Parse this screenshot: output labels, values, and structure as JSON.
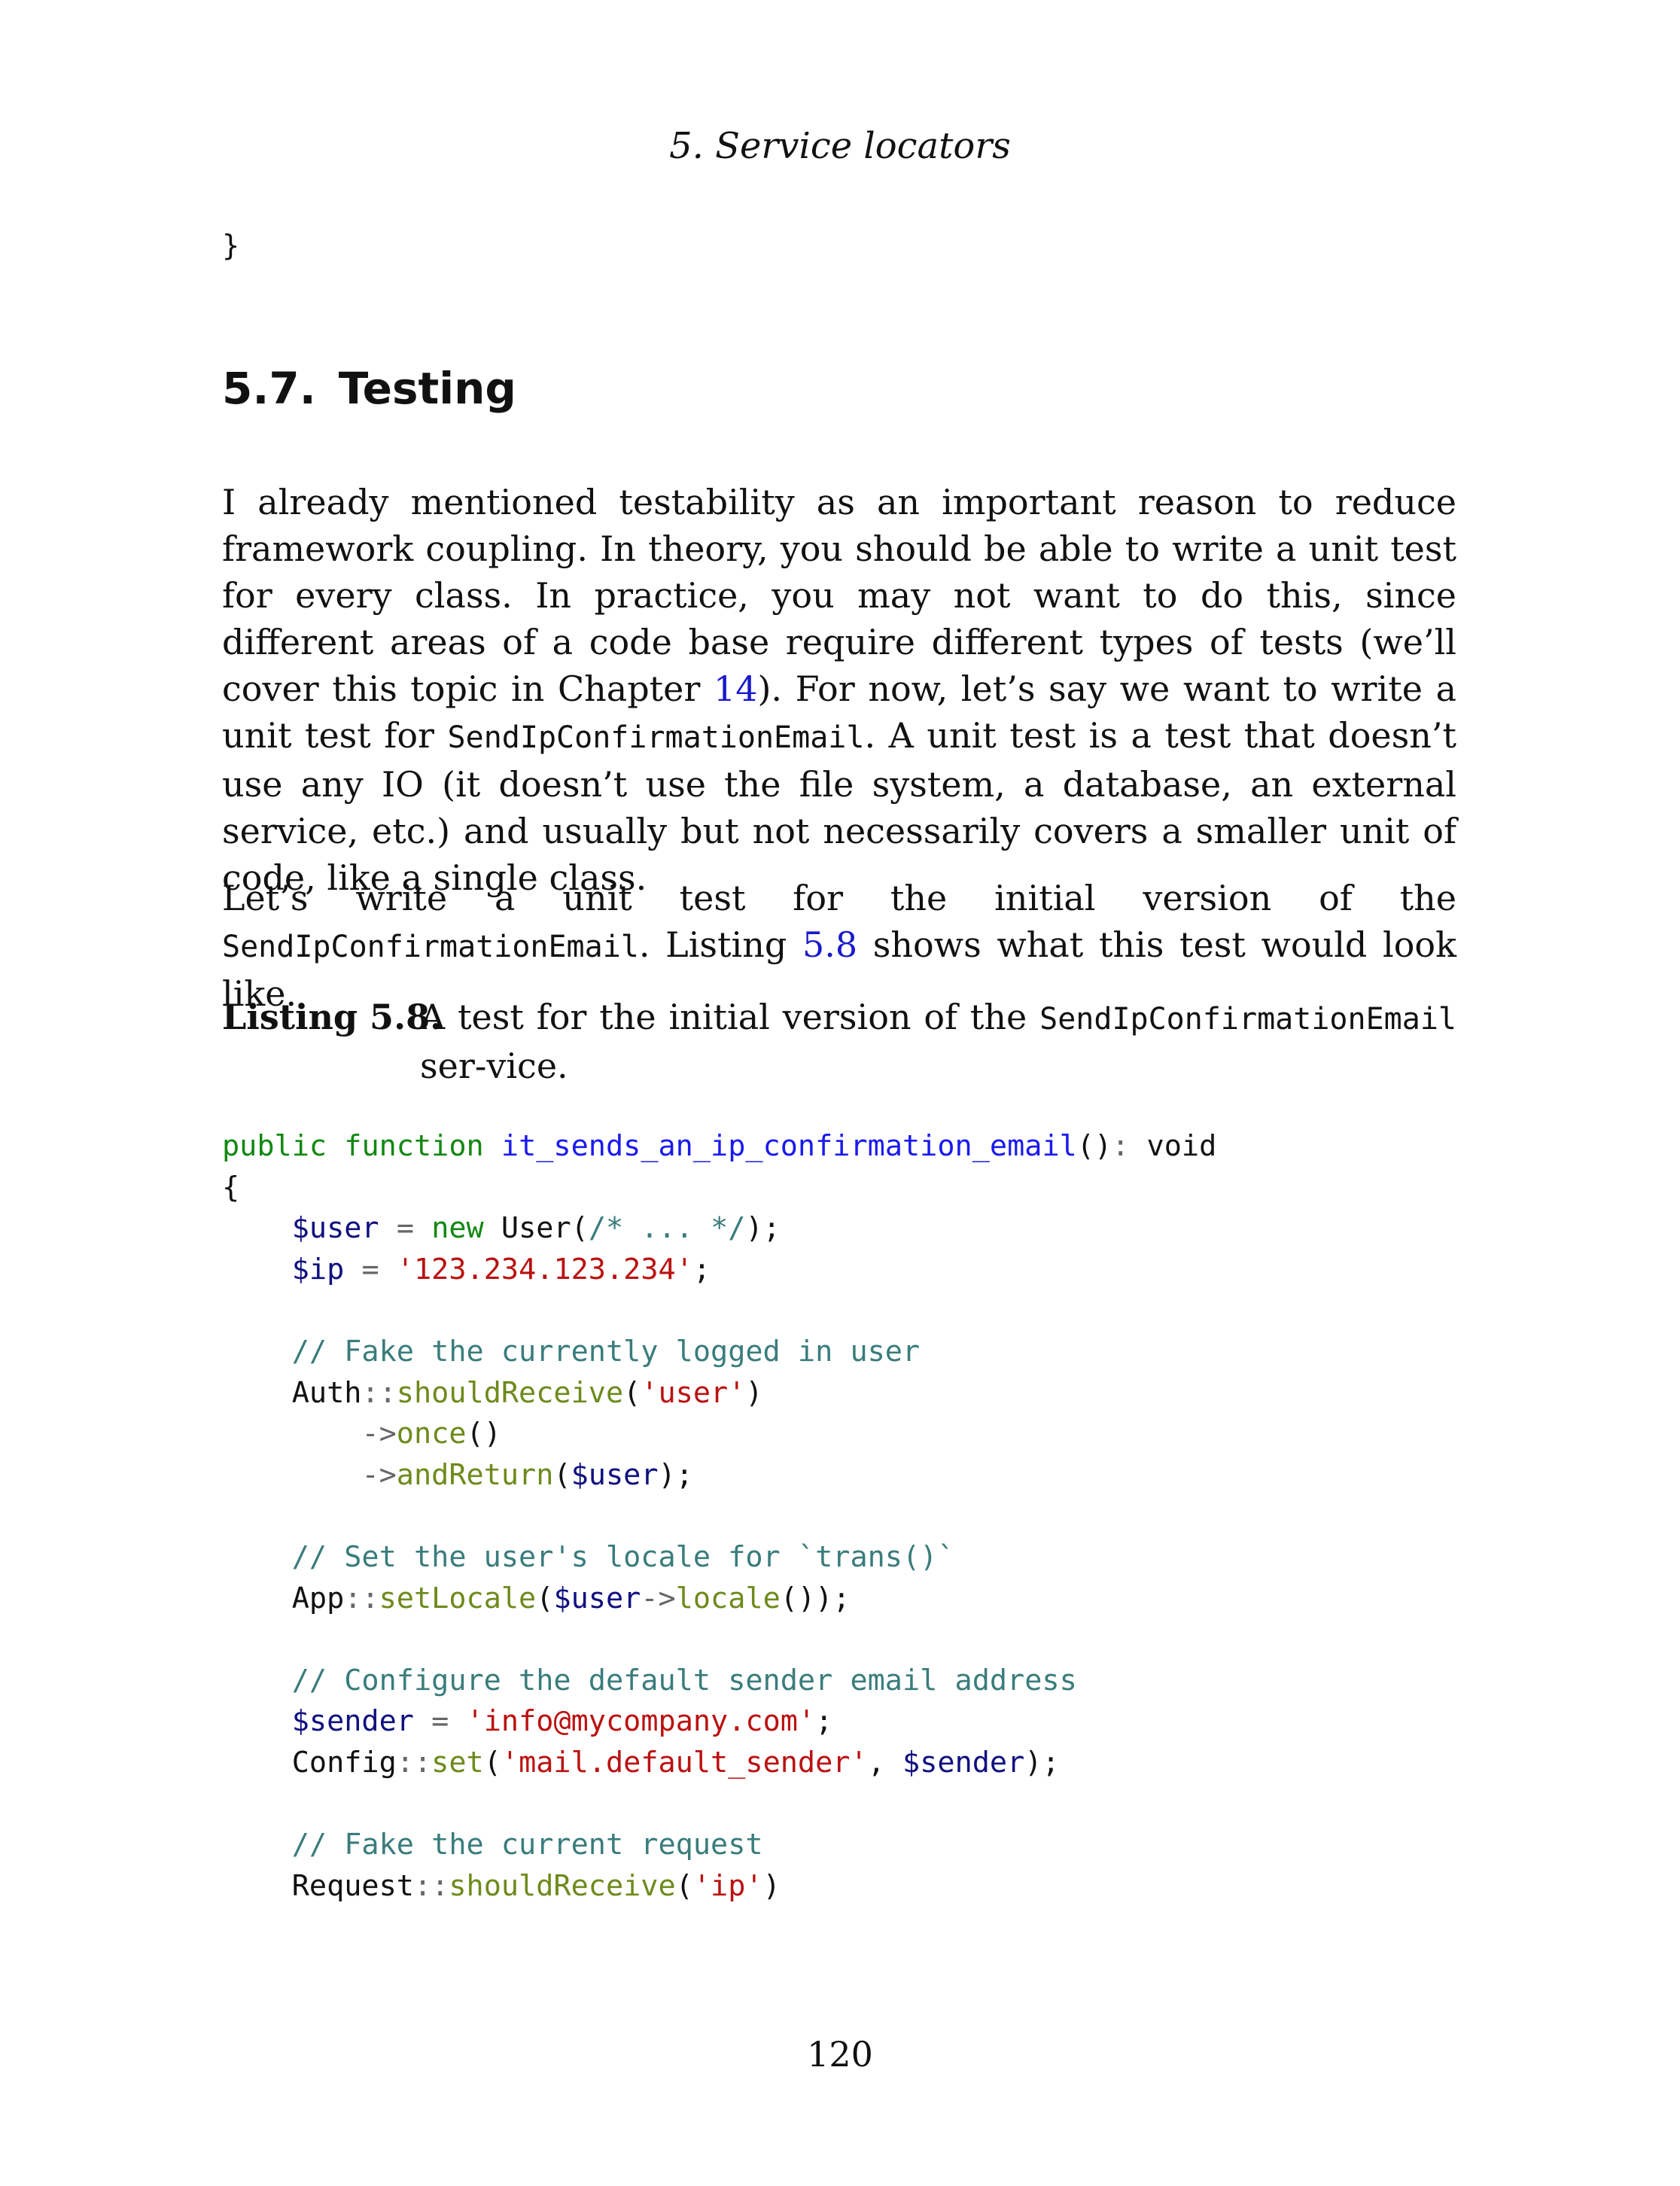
{
  "header": {
    "running_head": "5.  Service locators"
  },
  "code_top": {
    "line": "}"
  },
  "section": {
    "number": "5.7.",
    "title": "Testing"
  },
  "paragraph1": {
    "t1": "I already mentioned testability as an important reason to reduce framework coupling.  In theory, you should be able to write a unit test for every class. In practice, you may not want to do this, since different areas of a code base require different types of tests (we’ll cover this topic in Chapter ",
    "chapter_ref": "14",
    "t2": "). For now, let’s say we want to write a unit test for ",
    "code1": "SendIpConfirmationEmail",
    "t3": ". A unit test is a test that doesn’t use any IO (it doesn’t use the file system, a database, an external service, etc.)  and usually but not necessarily covers a smaller unit of code, like a single class."
  },
  "paragraph2": {
    "t1": "Let’s write a unit test for the initial version of the ",
    "code1": "SendIpConfirmationEmail",
    "t2": ". Listing ",
    "listing_ref": "5.8",
    "t3": " shows what this test would look like."
  },
  "listing": {
    "label": "Listing 5.8.",
    "caption_t1": "A test for the initial version of the ",
    "caption_code": "SendIpConfirmationEmail",
    "caption_t2": " ser-vice."
  },
  "code": {
    "public": "public",
    "function": "function",
    "fn_name": "it_sends_an_ip_confirmation_email",
    "parens": "()",
    "colon": ":",
    "void": "void",
    "open_brace": "{",
    "user_var": "$user",
    "eq": "=",
    "new": "new",
    "user_class": "User(",
    "inline_comment": "/* ... */",
    "close_call": ");",
    "ip_var": "$ip",
    "ip_str": "'123.234.123.234'",
    "semicolon": ";",
    "comment1": "// Fake the currently logged in user",
    "auth": "Auth",
    "scope": "::",
    "should_receive": "shouldReceive",
    "paren_open": "(",
    "user_str": "'user'",
    "paren_close": ")",
    "arrow": "->",
    "once": "once",
    "empty_parens": "()",
    "and_return": "andReturn",
    "end_stmt": ");",
    "comment2": "// Set the user's locale for `trans()`",
    "app": "App",
    "set_locale": "setLocale",
    "locale": "locale",
    "double_close": "());",
    "comment3": "// Configure the default sender email address",
    "sender_var": "$sender",
    "sender_str": "'info@mycompany.com'",
    "config": "Config",
    "set": "set",
    "mail_key": "'mail.default_sender'",
    "comma": ",",
    "comment4": "// Fake the current request",
    "request": "Request",
    "ip_key": "'ip'"
  },
  "footer": {
    "page_number": "120"
  }
}
